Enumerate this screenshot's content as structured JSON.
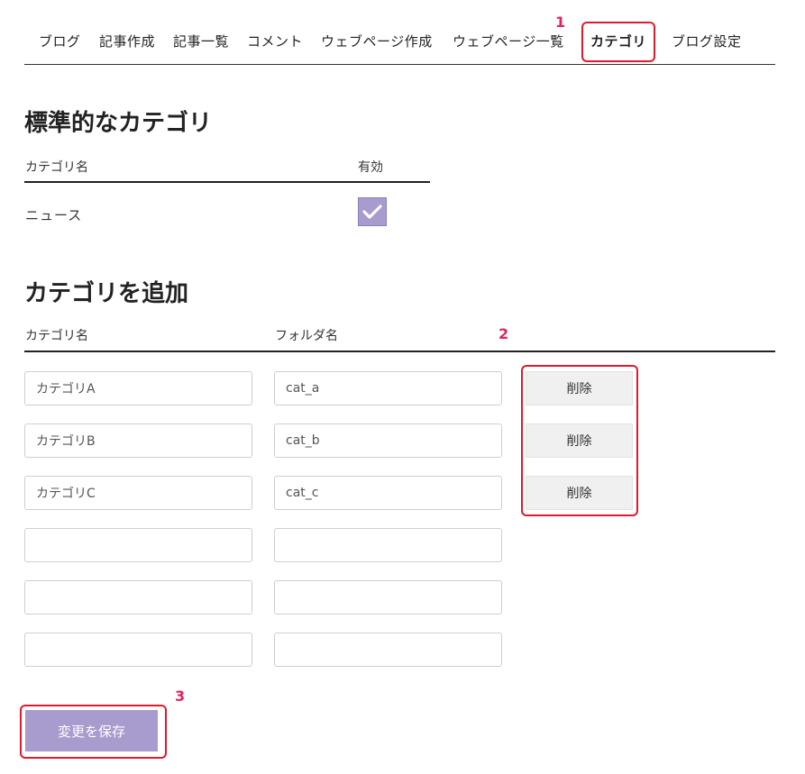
{
  "nav": {
    "items": [
      "ブログ",
      "記事作成",
      "記事一覧",
      "コメント",
      "ウェブページ作成",
      "ウェブページ一覧",
      "カテゴリ",
      "ブログ設定"
    ],
    "active": "カテゴリ"
  },
  "annotations": [
    "1",
    "2",
    "3"
  ],
  "standard": {
    "title": "標準的なカテゴリ",
    "col_name": "カテゴリ名",
    "col_enabled": "有効",
    "rows": [
      {
        "name": "ニュース",
        "enabled": true
      }
    ]
  },
  "add": {
    "title": "カテゴリを追加",
    "col_name": "カテゴリ名",
    "col_folder": "フォルダ名",
    "rows": [
      {
        "name": "カテゴリA",
        "folder": "cat_a",
        "delete_label": "削除"
      },
      {
        "name": "カテゴリB",
        "folder": "cat_b",
        "delete_label": "削除"
      },
      {
        "name": "カテゴリC",
        "folder": "cat_c",
        "delete_label": "削除"
      },
      {
        "name": "",
        "folder": ""
      },
      {
        "name": "",
        "folder": ""
      },
      {
        "name": "",
        "folder": ""
      }
    ]
  },
  "save_label": "変更を保存",
  "colors": {
    "accent": "#a89bcd",
    "annotation": "#e0192f"
  }
}
